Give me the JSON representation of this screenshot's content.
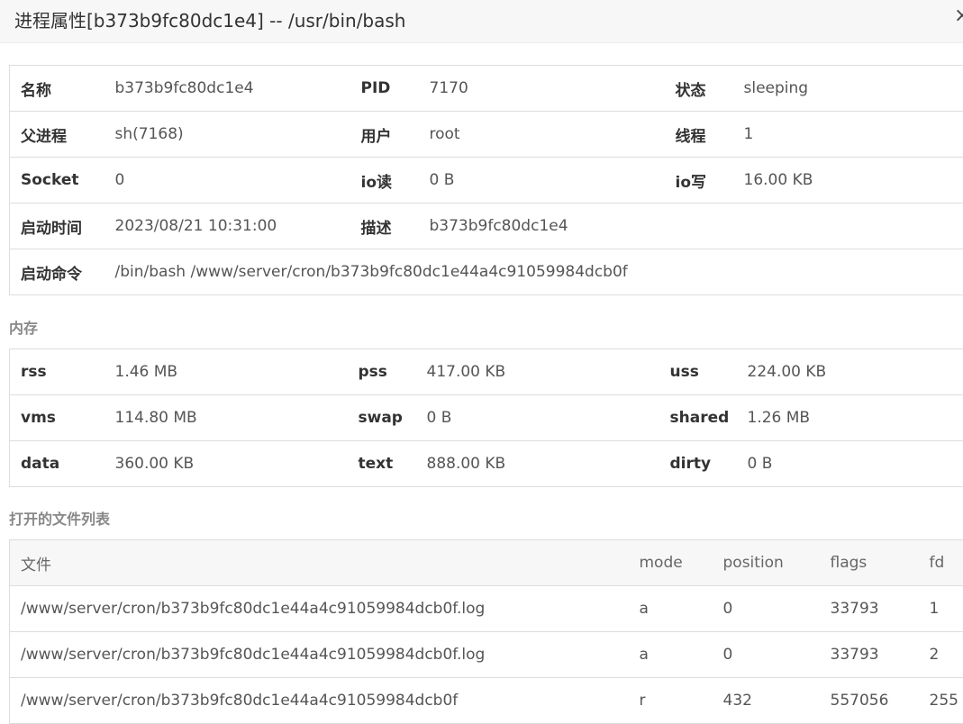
{
  "window": {
    "title": "进程属性[b373b9fc80dc1e4] -- /usr/bin/bash",
    "close_glyph": "×"
  },
  "info": {
    "rows": [
      [
        {
          "k": "名称",
          "v": "b373b9fc80dc1e4"
        },
        {
          "k": "PID",
          "v": "7170"
        },
        {
          "k": "状态",
          "v": "sleeping"
        }
      ],
      [
        {
          "k": "父进程",
          "v": "sh(7168)"
        },
        {
          "k": "用户",
          "v": "root"
        },
        {
          "k": "线程",
          "v": "1"
        }
      ],
      [
        {
          "k": "Socket",
          "v": "0"
        },
        {
          "k": "io读",
          "v": "0 B"
        },
        {
          "k": "io写",
          "v": "16.00 KB"
        }
      ],
      [
        {
          "k": "启动时间",
          "v": "2023/08/21 10:31:00"
        },
        {
          "k": "描述",
          "v": "b373b9fc80dc1e4"
        }
      ],
      [
        {
          "k": "启动命令",
          "v": "/bin/bash /www/server/cron/b373b9fc80dc1e44a4c91059984dcb0f"
        }
      ]
    ]
  },
  "memory": {
    "title": "内存",
    "rows": [
      [
        {
          "k": "rss",
          "v": "1.46 MB"
        },
        {
          "k": "pss",
          "v": "417.00 KB"
        },
        {
          "k": "uss",
          "v": "224.00 KB"
        }
      ],
      [
        {
          "k": "vms",
          "v": "114.80 MB"
        },
        {
          "k": "swap",
          "v": "0 B"
        },
        {
          "k": "shared",
          "v": "1.26 MB"
        }
      ],
      [
        {
          "k": "data",
          "v": "360.00 KB"
        },
        {
          "k": "text",
          "v": "888.00 KB"
        },
        {
          "k": "dirty",
          "v": "0 B"
        }
      ]
    ]
  },
  "files": {
    "title": "打开的文件列表",
    "headers": [
      "文件",
      "mode",
      "position",
      "flags",
      "fd"
    ],
    "rows": [
      [
        "/www/server/cron/b373b9fc80dc1e44a4c91059984dcb0f.log",
        "a",
        "0",
        "33793",
        "1"
      ],
      [
        "/www/server/cron/b373b9fc80dc1e44a4c91059984dcb0f.log",
        "a",
        "0",
        "33793",
        "2"
      ],
      [
        "/www/server/cron/b373b9fc80dc1e44a4c91059984dcb0f",
        "r",
        "432",
        "557056",
        "255"
      ]
    ]
  }
}
